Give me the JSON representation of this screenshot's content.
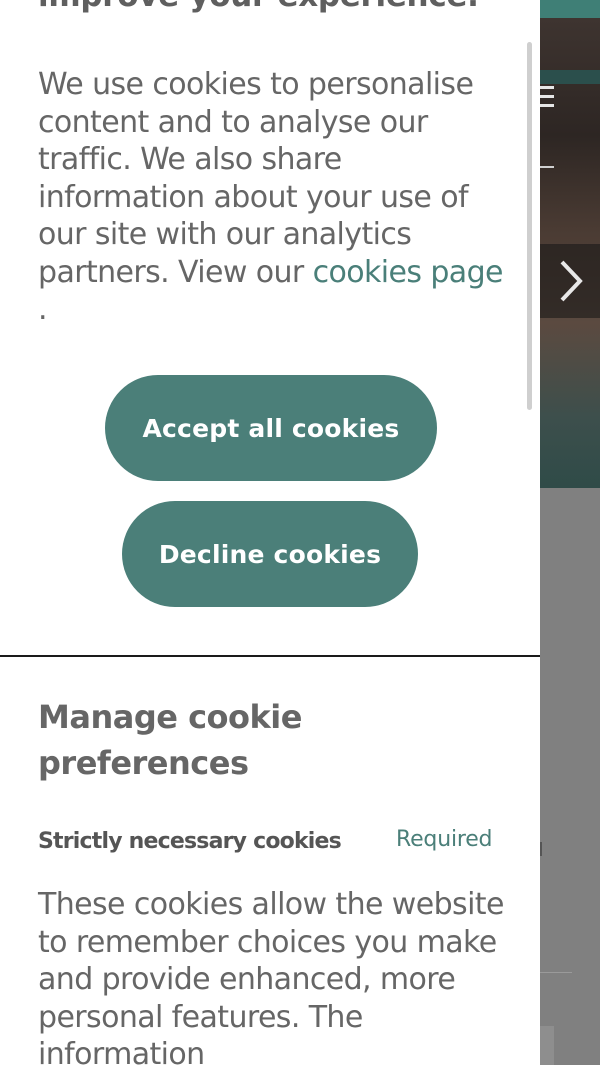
{
  "background": {
    "menu_icon": "hamburger-menu-icon",
    "next_icon": "chevron-right-icon",
    "accent_color": "#3f7f76"
  },
  "cookie_banner": {
    "heading": "improve your experience.",
    "intro_text": "We use cookies to personalise content and to analyse our traffic. We also share information about your use of our site with our analytics partners. View our",
    "cookies_link": "cookies page",
    "intro_end": ".",
    "accept_label": "Accept all cookies",
    "decline_label": "Decline cookies",
    "button_color": "#4b7f79"
  },
  "preferences": {
    "title": "Manage cookie preferences",
    "categories": [
      {
        "name": "Strictly necessary cookies",
        "status": "Required",
        "description": "These cookies allow the website to remember choices you make and provide enhanced, more personal features. The information"
      }
    ]
  }
}
